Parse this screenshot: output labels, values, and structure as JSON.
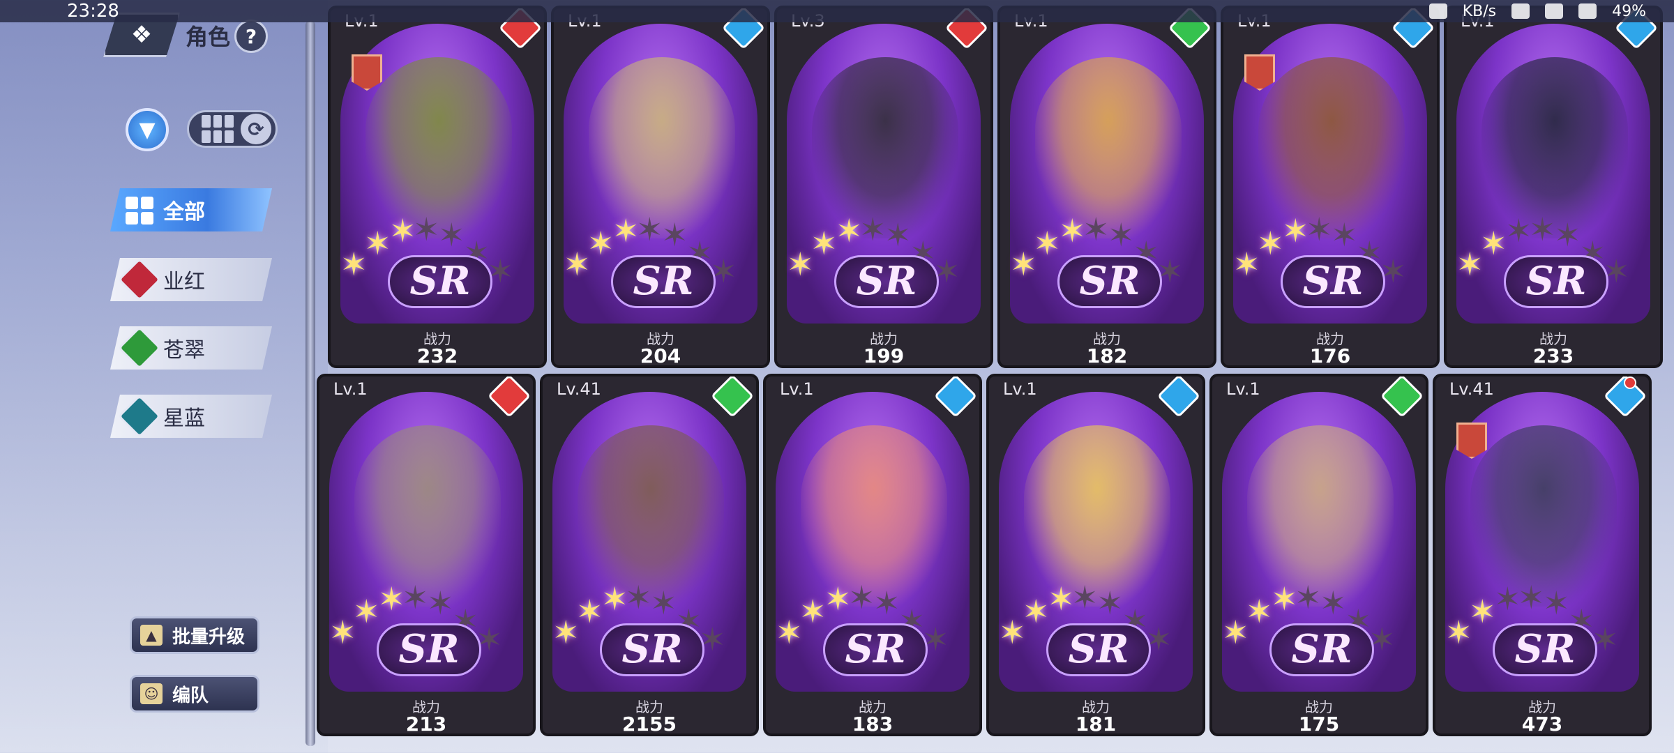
{
  "status": {
    "time": "23:28",
    "net": "KB/s",
    "battery": "49%"
  },
  "header": {
    "title": "角色",
    "help": "?"
  },
  "categories": [
    {
      "label": "全部",
      "active": true
    },
    {
      "label": "业红",
      "color": "#c0283a"
    },
    {
      "label": "苍翠",
      "color": "#2e9a3a"
    },
    {
      "label": "星蓝",
      "color": "#1e7a8a"
    }
  ],
  "bottom": {
    "batch_upgrade": "批量升级",
    "team": "编队"
  },
  "power_label": "战力",
  "rarity": "SR",
  "cards": [
    {
      "lv": "Lv.1",
      "element": "red",
      "power": "232",
      "lit": 3,
      "badge": true,
      "tone": "#7b8a3a"
    },
    {
      "lv": "Lv.1",
      "element": "blue",
      "power": "204",
      "lit": 3,
      "badge": false,
      "tone": "#c9b27a"
    },
    {
      "lv": "Lv.3",
      "element": "red",
      "power": "199",
      "lit": 3,
      "badge": false,
      "tone": "#2e2a36"
    },
    {
      "lv": "Lv.1",
      "element": "green",
      "power": "182",
      "lit": 3,
      "badge": false,
      "tone": "#d9a54a"
    },
    {
      "lv": "Lv.1",
      "element": "blue",
      "power": "176",
      "lit": 3,
      "badge": true,
      "tone": "#8a5530"
    },
    {
      "lv": "Lv.1",
      "element": "blue",
      "power": "233",
      "lit": 2,
      "badge": false,
      "tone": "#22243a"
    },
    {
      "lv": "Lv.1",
      "element": "red",
      "power": "213",
      "lit": 3,
      "badge": false,
      "tone": "#9a8a7a"
    },
    {
      "lv": "Lv.41",
      "element": "green",
      "power": "2155",
      "lit": 3,
      "badge": false,
      "tone": "#7a5a4a"
    },
    {
      "lv": "Lv.1",
      "element": "blue",
      "power": "183",
      "lit": 3,
      "badge": false,
      "tone": "#e88a7a"
    },
    {
      "lv": "Lv.1",
      "element": "blue",
      "power": "181",
      "lit": 3,
      "badge": false,
      "tone": "#e8c45a"
    },
    {
      "lv": "Lv.1",
      "element": "green",
      "power": "175",
      "lit": 3,
      "badge": false,
      "tone": "#c9a880"
    },
    {
      "lv": "Lv.41",
      "element": "blue",
      "power": "473",
      "lit": 2,
      "badge": true,
      "tone": "#3a3a5a"
    }
  ]
}
